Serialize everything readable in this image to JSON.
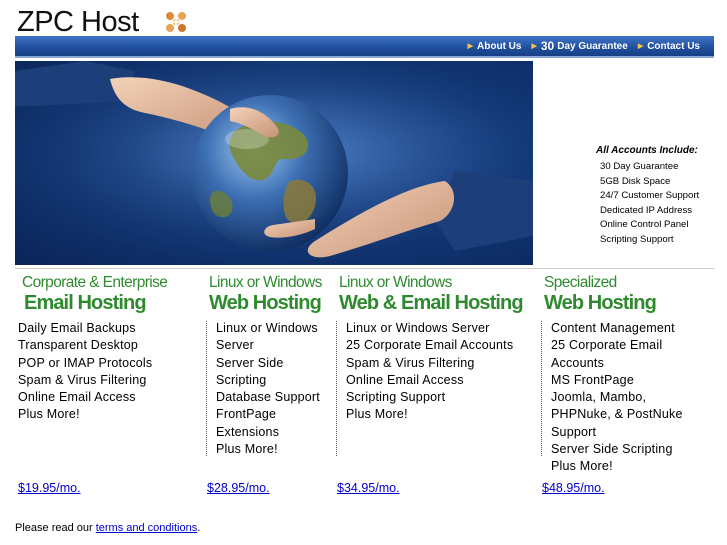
{
  "logo": {
    "text": "ZPC Host",
    "icon": "logo-icon"
  },
  "nav": {
    "about": "About Us",
    "guarantee_num": "30",
    "guarantee_text": "Day Guarantee",
    "contact": "Contact Us"
  },
  "accounts": {
    "title": "All Accounts Include:",
    "items": [
      "30 Day Guarantee",
      "5GB Disk Space",
      "24/7 Customer Support",
      "Dedicated IP Address",
      "Online Control Panel",
      "Scripting Support"
    ]
  },
  "plans": [
    {
      "line1": "Corporate & Enterprise",
      "line2": "Email Hosting",
      "features": [
        "Daily Email Backups",
        "Transparent Desktop",
        "POP or IMAP Protocols",
        "Spam & Virus Filtering",
        "Online Email Access",
        "Plus More!"
      ],
      "price": "$19.95/mo."
    },
    {
      "line1": "Linux or Windows",
      "line2": "Web Hosting",
      "features": [
        "Linux or Windows",
        "Server",
        "Server Side",
        "Scripting",
        "Database Support",
        "FrontPage",
        "Extensions",
        "Plus More!"
      ],
      "price": "$28.95/mo."
    },
    {
      "line1": "Linux or Windows",
      "line2": "Web & Email Hosting",
      "features": [
        "Linux or Windows Server",
        "25 Corporate Email Accounts",
        "Spam & Virus Filtering",
        "Online Email Access",
        "Scripting Support",
        "Plus More!"
      ],
      "price": "$34.95/mo."
    },
    {
      "line1": "Specialized",
      "line2": "Web Hosting",
      "features": [
        "Content Management",
        "25 Corporate Email",
        "Accounts",
        "MS FrontPage",
        "Joomla, Mambo,",
        "PHPNuke, & PostNuke",
        "Support",
        "Server Side Scripting",
        "Plus More!"
      ],
      "price": "$48.95/mo."
    }
  ],
  "footer": {
    "prefix": "Please read our ",
    "link": "terms and conditions",
    "suffix": "."
  },
  "colors": {
    "nav_blue": "#1f4e9c",
    "heading_green": "#2f8a2f",
    "link_blue": "#0000cc",
    "arrow_gold": "#f0c050"
  }
}
